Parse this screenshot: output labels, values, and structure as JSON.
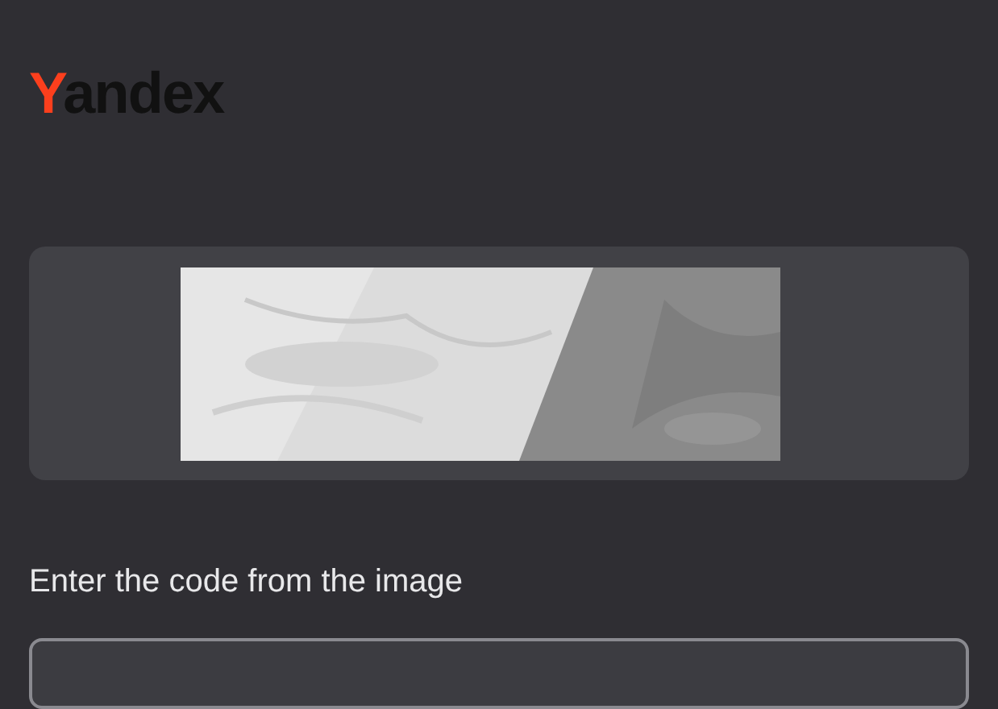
{
  "logo": {
    "accent": "Y",
    "rest": "andex"
  },
  "answer": {
    "label": "Enter the code from the image"
  }
}
